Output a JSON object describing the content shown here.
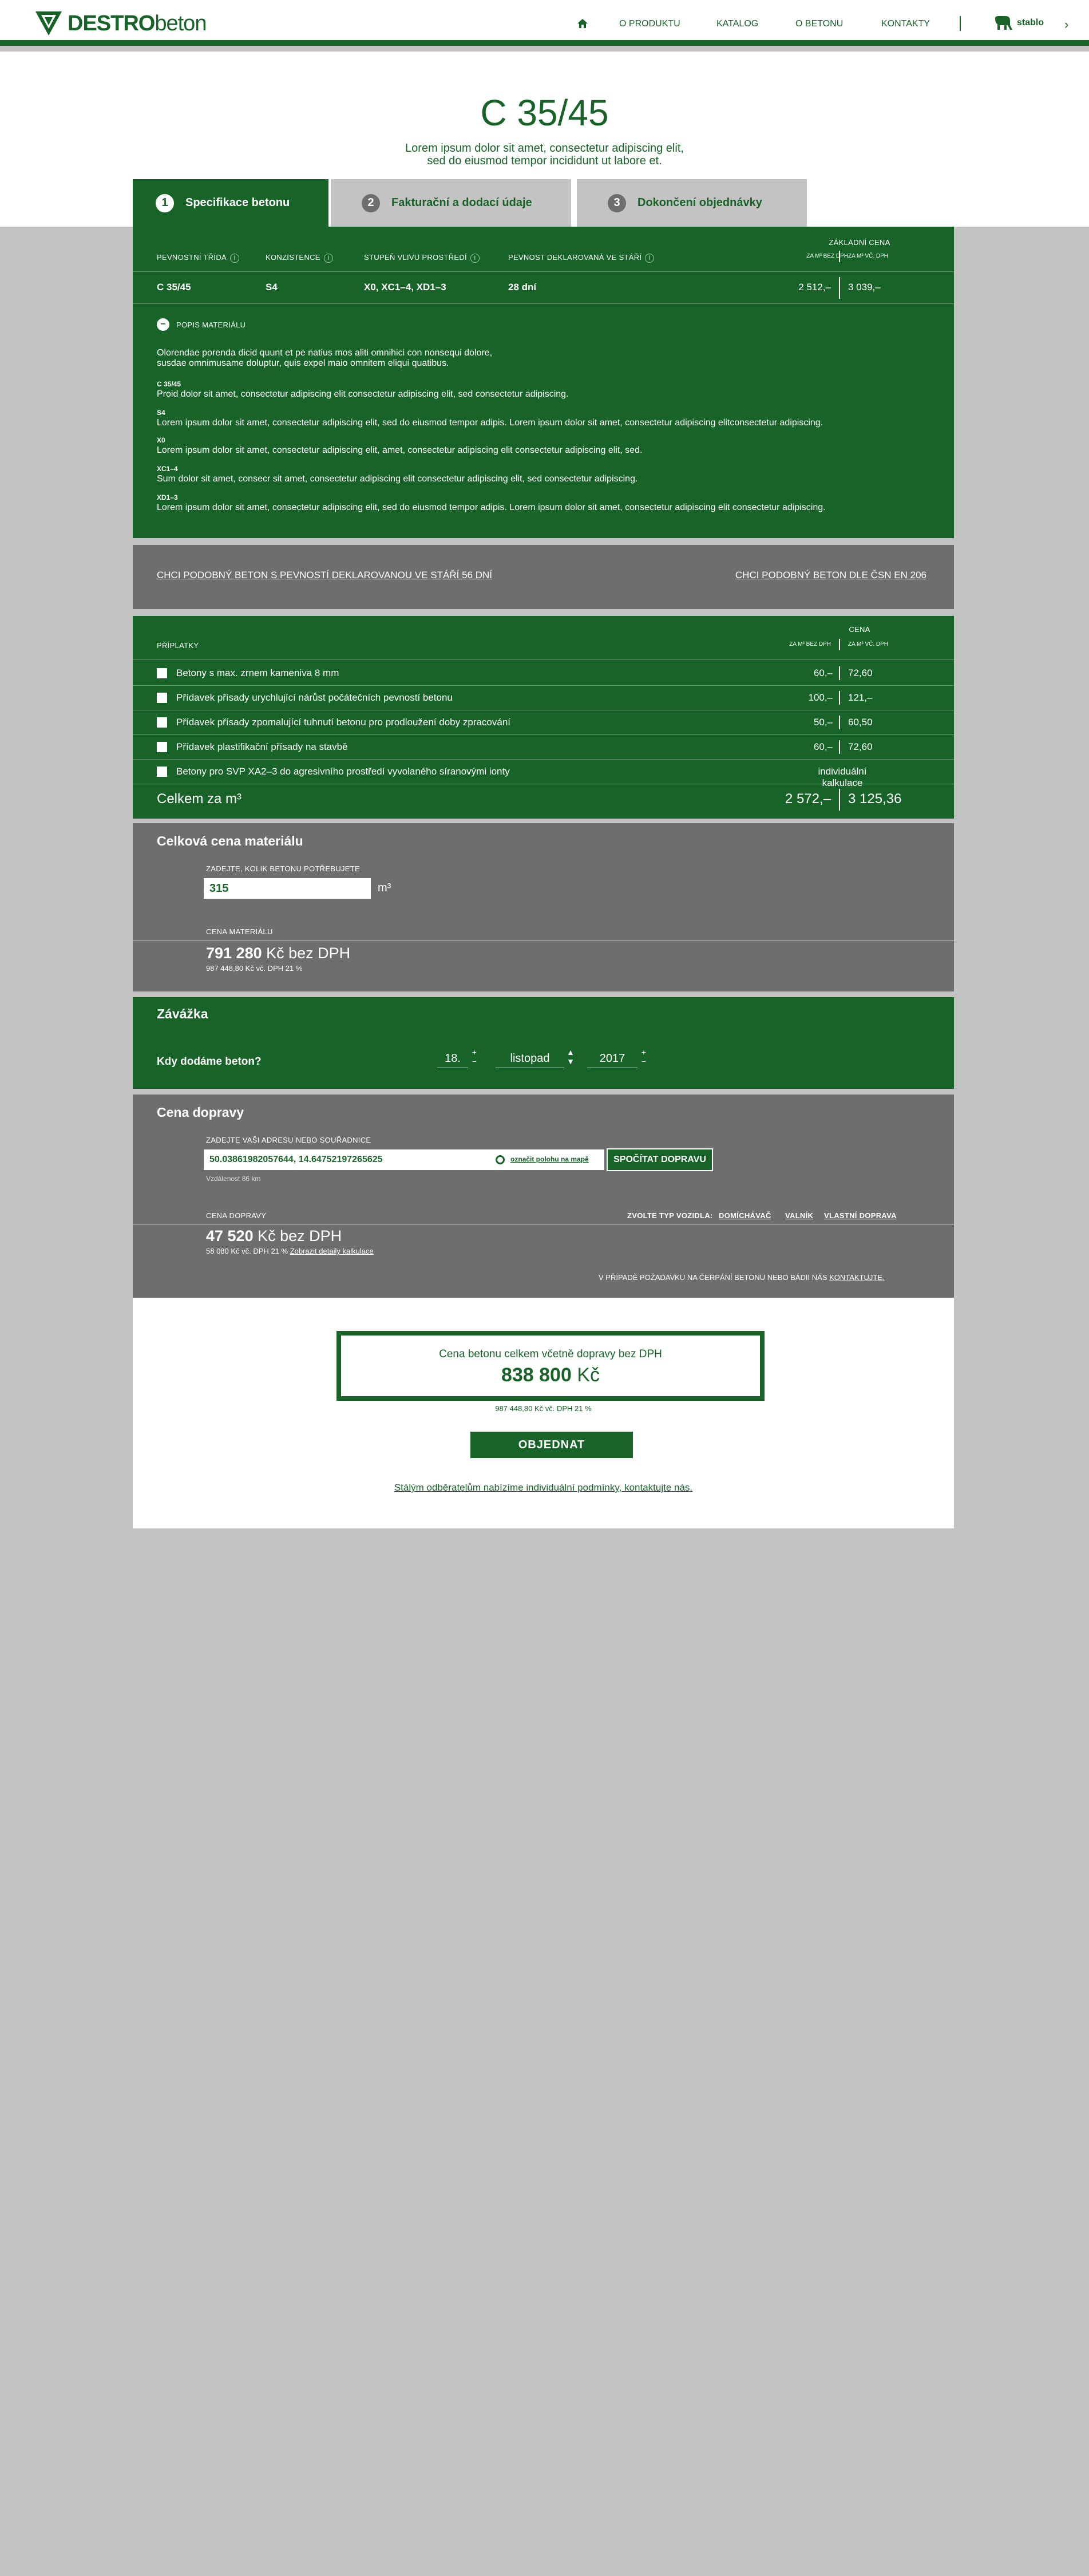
{
  "brand": {
    "logo_strong": "DESTRO",
    "logo_light": "beton",
    "partner": "stablo"
  },
  "colors": {
    "primary": "#176328",
    "gray": "#6e6e6e",
    "background": "#c2c3c2"
  },
  "nav": [
    "O PRODUKTU",
    "KATALOG",
    "O BETONU",
    "KONTAKTY"
  ],
  "hero": {
    "title": "C 35/45",
    "subtitle_1": "Lorem ipsum dolor sit amet, consectetur adipiscing elit,",
    "subtitle_2": "sed do eiusmod tempor incididunt ut labore et."
  },
  "steps": [
    {
      "num": "1",
      "label": "Specifikace betonu"
    },
    {
      "num": "2",
      "label": "Fakturační a dodací údaje"
    },
    {
      "num": "3",
      "label": "Dokončení objednávky"
    }
  ],
  "spec": {
    "headers": [
      "PEVNOSTNÍ TŘÍDA",
      "KONZISTENCE",
      "STUPEŇ VLIVU PROSTŘEDÍ",
      "PEVNOST DEKLAROVANÁ VE STÁŘÍ"
    ],
    "base_price_label": "ZÁKLADNÍ CENA",
    "price_col_1": "ZA M³ BEZ DPH",
    "price_col_2": "ZA M³ VČ. DPH",
    "values": [
      "C 35/45",
      "S4",
      "X0, XC1–4, XD1–3",
      "28 dní"
    ],
    "price_1": "2 512,–",
    "price_2": "3 039,–",
    "desc_toggle": "POPIS MATERIÁLU",
    "intro_1": "Olorendae porenda dicid quunt et pe natius mos aliti omnihici con nonsequi dolore,",
    "intro_2": "susdae omnimusame doluptur, quis expel maio omnitem eliqui quatibus.",
    "items": [
      {
        "key": "C 35/45",
        "text": "Proid dolor sit amet, consectetur adipiscing elit consectetur adipiscing elit, sed consectetur adipiscing."
      },
      {
        "key": "S4",
        "text": "Lorem ipsum dolor sit amet, consectetur adipiscing elit, sed do eiusmod tempor adipis. Lorem ipsum dolor sit amet, consectetur adipiscing elitconsectetur adipiscing."
      },
      {
        "key": "X0",
        "text": "Lorem ipsum dolor sit amet, consectetur adipiscing elit, amet, consectetur adipiscing elit consectetur adipiscing elit, sed."
      },
      {
        "key": "XC1–4",
        "text": "Sum dolor sit amet, consecr sit amet, consectetur adipiscing elit consectetur adipiscing elit, sed consectetur adipiscing."
      },
      {
        "key": "XD1–3",
        "text": "Lorem ipsum dolor sit amet, consectetur adipiscing elit, sed do eiusmod tempor adipis. Lorem ipsum dolor sit amet, consectetur adipiscing elit consectetur adipiscing."
      }
    ]
  },
  "similar": {
    "left": "CHCI PODOBNÝ BETON S PEVNOSTÍ DEKLAROVANOU VE STÁŘÍ 56 DNÍ",
    "right": "CHCI PODOBNÝ BETON DLE ČSN EN 206"
  },
  "extras": {
    "title": "PŘÍPLATKY",
    "price_label": "CENA",
    "col_1": "ZA M³ BEZ DPH",
    "col_2": "ZA M³ VČ. DPH",
    "rows": [
      {
        "label": "Betony s max. zrnem kameniva 8 mm",
        "p1": "60,–",
        "p2": "72,60"
      },
      {
        "label": "Přídavek přísady urychlující nárůst počátečních pevností betonu",
        "p1": "100,–",
        "p2": "121,–"
      },
      {
        "label": "Přídavek přísady zpomalující tuhnutí betonu pro prodloužení doby zpracování",
        "p1": "50,–",
        "p2": "60,50"
      },
      {
        "label": "Přídavek plastifikační přísady na stavbě",
        "p1": "60,–",
        "p2": "72,60"
      },
      {
        "label": "Betony pro SVP XA2–3 do agresivního prostředí vyvolaného síranovými ionty",
        "p1": "",
        "p2": "",
        "note": "individuální kalkulace"
      }
    ],
    "total_label": "Celkem za m³",
    "total_1": "2 572,–",
    "total_2": "3 125,36"
  },
  "material": {
    "title": "Celková cena materiálu",
    "input_label": "ZADEJTE, KOLIK BETONU POTŘEBUJETE",
    "quantity": "315",
    "unit": "m³",
    "price_label": "CENA MATERIÁLU",
    "price_num": "791 280",
    "price_suffix": "Kč bez DPH",
    "price_vat": "987 448,80 Kč vč. DPH 21 %"
  },
  "commitment": {
    "title": "Závážka",
    "question": "Kdy dodáme beton?",
    "day": "18.",
    "month": "listopad",
    "year": "2017"
  },
  "transport": {
    "title": "Cena dopravy",
    "input_label": "ZADEJTE VAŠI ADRESU NEBO SOUŘADNICE",
    "address": "50.03861982057644, 14.64752197265625",
    "map_link": "označit polohu na mapě",
    "calc_button": "SPOČÍTAT DOPRAVU",
    "distance": "Vzdálenost 86 km",
    "price_label": "CENA DOPRAVY",
    "vehicle_label": "ZVOLTE TYP VOZIDLA:",
    "vehicles": [
      "DOMÍCHÁVAČ",
      "VALNÍK",
      "VLASTNÍ DOPRAVA"
    ],
    "price_num": "47 520",
    "price_suffix": "Kč bez DPH",
    "price_vat": "58 080 Kč vč. DPH 21 %",
    "detail_link": "Zobrazit detaily kalkulace",
    "pump_note": "V PŘÍPADĚ POŽADAVKU NA ČERPÁNÍ BETONU NEBO BÁDII NÁS",
    "pump_link": "KONTAKTUJTE."
  },
  "summary": {
    "label": "Cena betonu celkem včetně dopravy bez DPH",
    "total_num": "838 800",
    "currency": "Kč",
    "vat": "987 448,80 Kč vč. DPH 21 %",
    "order_button": "OBJEDNAT",
    "footer_link": "Stálým odběratelům nabízíme individuální podmínky, kontaktujte nás."
  }
}
